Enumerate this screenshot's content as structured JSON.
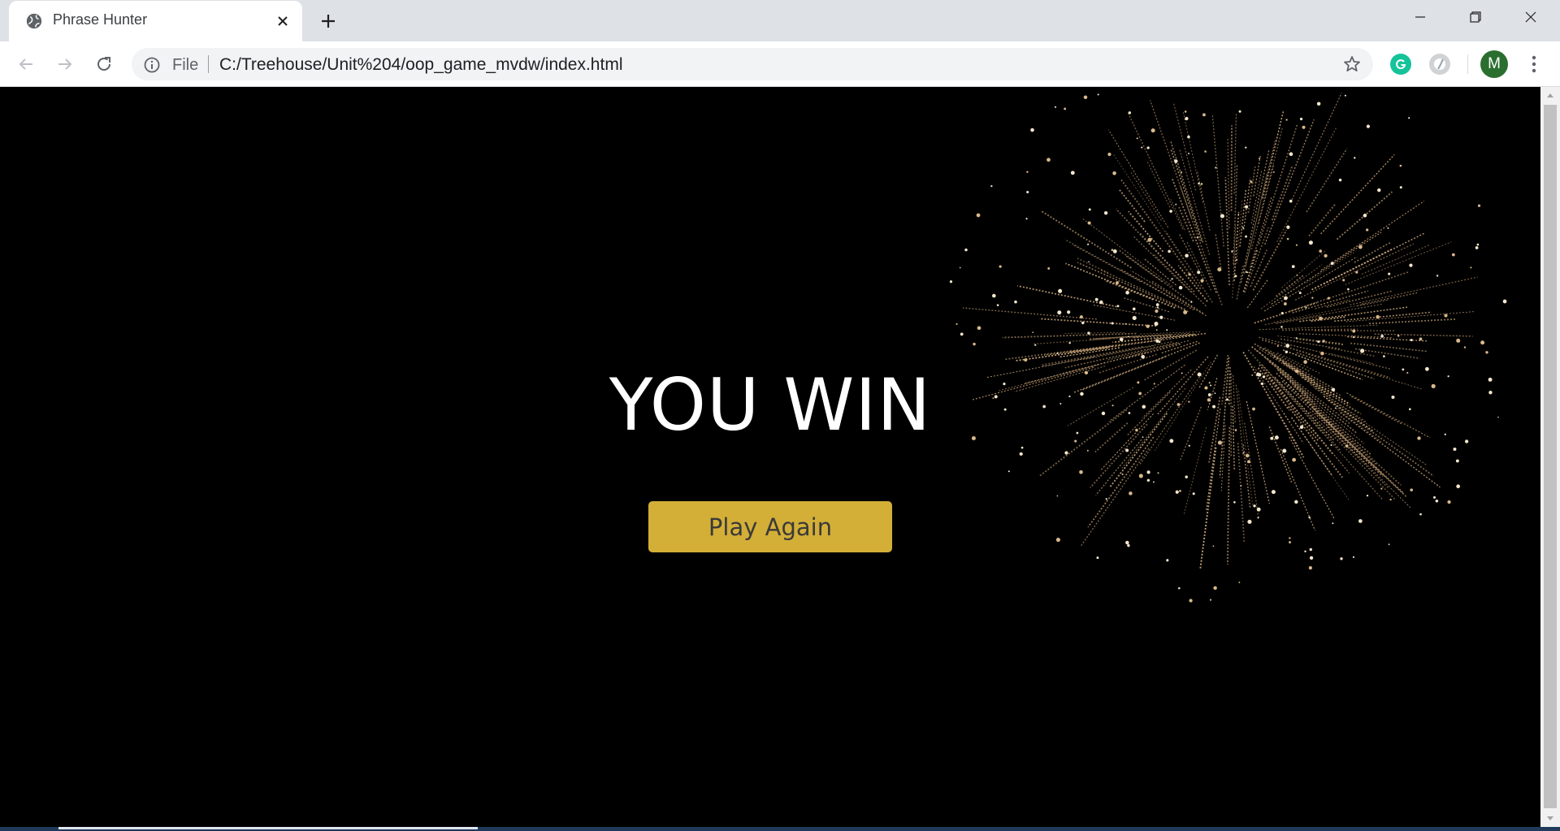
{
  "browser": {
    "tab": {
      "title": "Phrase Hunter",
      "favicon": "globe-icon"
    },
    "toolbar": {
      "scheme_label": "File",
      "url": "C:/Treehouse/Unit%204/oop_game_mvdw/index.html",
      "profile_initial": "M"
    },
    "extensions": [
      "grammarly-icon",
      "extension-icon"
    ],
    "window_controls": [
      "minimize-icon",
      "restore-icon",
      "close-icon"
    ]
  },
  "page": {
    "result_title": "YOU WIN",
    "play_again_label": "Play Again",
    "background_color": "#000000",
    "button_color": "#d4af37"
  }
}
